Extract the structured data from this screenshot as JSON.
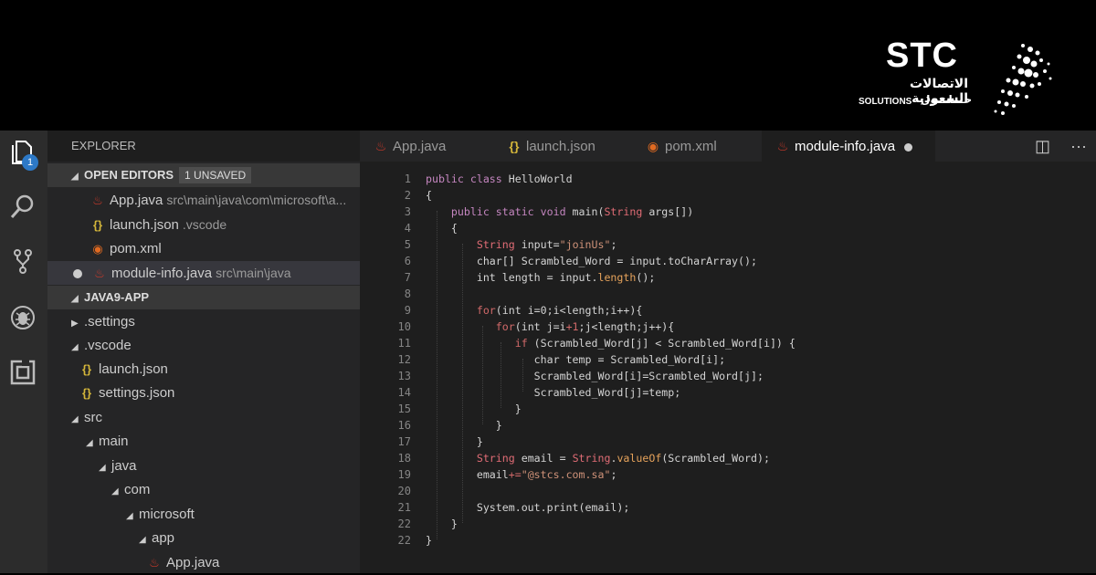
{
  "banner": {
    "logo_text": "STC",
    "logo_arabic": "الاتصالات السعودية",
    "logo_solutions": "SOLUTIONS",
    "logo_solutions_ar": "حـــلـــول"
  },
  "activity_bar": {
    "badge_count": "1",
    "icons": [
      "files-icon",
      "search-icon",
      "source-control-icon",
      "debug-icon",
      "extensions-icon"
    ]
  },
  "sidebar": {
    "title": "EXPLORER",
    "open_editors_label": "OPEN EDITORS",
    "unsaved_badge": "1 UNSAVED",
    "open_editors": [
      {
        "name": "App.java",
        "path": "src\\main\\java\\com\\microsoft\\a...",
        "icon": "java-icon"
      },
      {
        "name": "launch.json",
        "path": ".vscode",
        "icon": "json-icon"
      },
      {
        "name": "pom.xml",
        "path": "",
        "icon": "rss-icon"
      },
      {
        "name": "module-info.java",
        "path": "src\\main\\java",
        "icon": "java-icon"
      }
    ],
    "project_label": "JAVA9-APP",
    "tree": [
      {
        "label": ".settings",
        "arrow": "▶"
      },
      {
        "label": ".vscode",
        "arrow": "◢"
      },
      {
        "label": "launch.json",
        "icon": "{}"
      },
      {
        "label": "settings.json",
        "icon": "{}"
      },
      {
        "label": "src",
        "arrow": "◢"
      },
      {
        "label": "main",
        "arrow": "◢"
      },
      {
        "label": "java",
        "arrow": "◢"
      },
      {
        "label": "com",
        "arrow": "◢"
      },
      {
        "label": "microsoft",
        "arrow": "◢"
      },
      {
        "label": "app",
        "arrow": "◢"
      },
      {
        "label": "App.java",
        "icon": "java"
      }
    ]
  },
  "tabs": [
    {
      "label": "App.java"
    },
    {
      "label": "launch.json"
    },
    {
      "label": "pom.xml"
    },
    {
      "label": "module-info.java"
    }
  ],
  "editor": {
    "line_numbers": [
      "1",
      "2",
      "3",
      "4",
      "5",
      "6",
      "7",
      "8",
      "9",
      "10",
      "11",
      "12",
      "13",
      "14",
      "15",
      "16",
      "17",
      "18",
      "19",
      "20",
      "21",
      "22"
    ],
    "lines": [
      "public class HelloWorld",
      "{",
      "    public static void main(String args[])",
      "    {",
      "        String input=\"joinUs\";",
      "        char[] Scrambled_Word = input.toCharArray();",
      "        int length = input.length();",
      "",
      "        for(int i=0;i<length;i++){",
      "           for(int j=i+1;j<length;j++){",
      "              if (Scrambled_Word[j] < Scrambled_Word[i]) {",
      "                 char temp = Scrambled_Word[i];",
      "                 Scrambled_Word[i]=Scrambled_Word[j];",
      "                 Scrambled_Word[j]=temp;",
      "              }",
      "           }",
      "        }",
      "        String email = String.valueOf(Scrambled_Word);",
      "        email+=\"@stcs.com.sa\";",
      "",
      "        System.out.print(email);",
      "    }",
      "}"
    ]
  }
}
